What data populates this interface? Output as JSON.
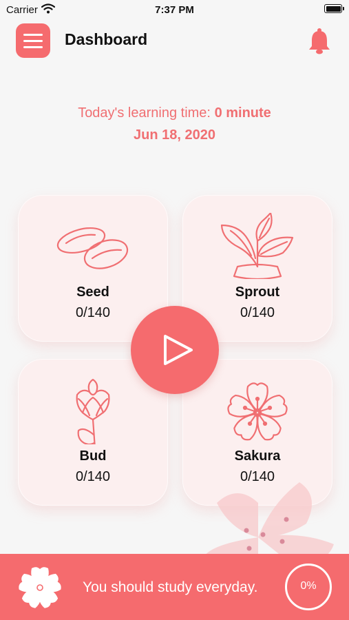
{
  "status_bar": {
    "carrier": "Carrier",
    "time": "7:37 PM"
  },
  "header": {
    "title": "Dashboard"
  },
  "summary": {
    "learning_time_label": "Today's learning time:",
    "learning_time_value": "0 minute",
    "date": "Jun 18, 2020"
  },
  "cards": [
    {
      "name": "Seed",
      "count": "0/140",
      "icon": "seed-icon"
    },
    {
      "name": "Sprout",
      "count": "0/140",
      "icon": "sprout-icon"
    },
    {
      "name": "Bud",
      "count": "0/140",
      "icon": "bud-icon"
    },
    {
      "name": "Sakura",
      "count": "0/140",
      "icon": "sakura-icon"
    }
  ],
  "footer": {
    "message": "You should study everyday.",
    "progress_label": "0%"
  },
  "colors": {
    "accent": "#f56b6e",
    "text_accent": "#f06f72",
    "card_bg": "#fcefef",
    "page_bg": "#f6f6f6"
  }
}
